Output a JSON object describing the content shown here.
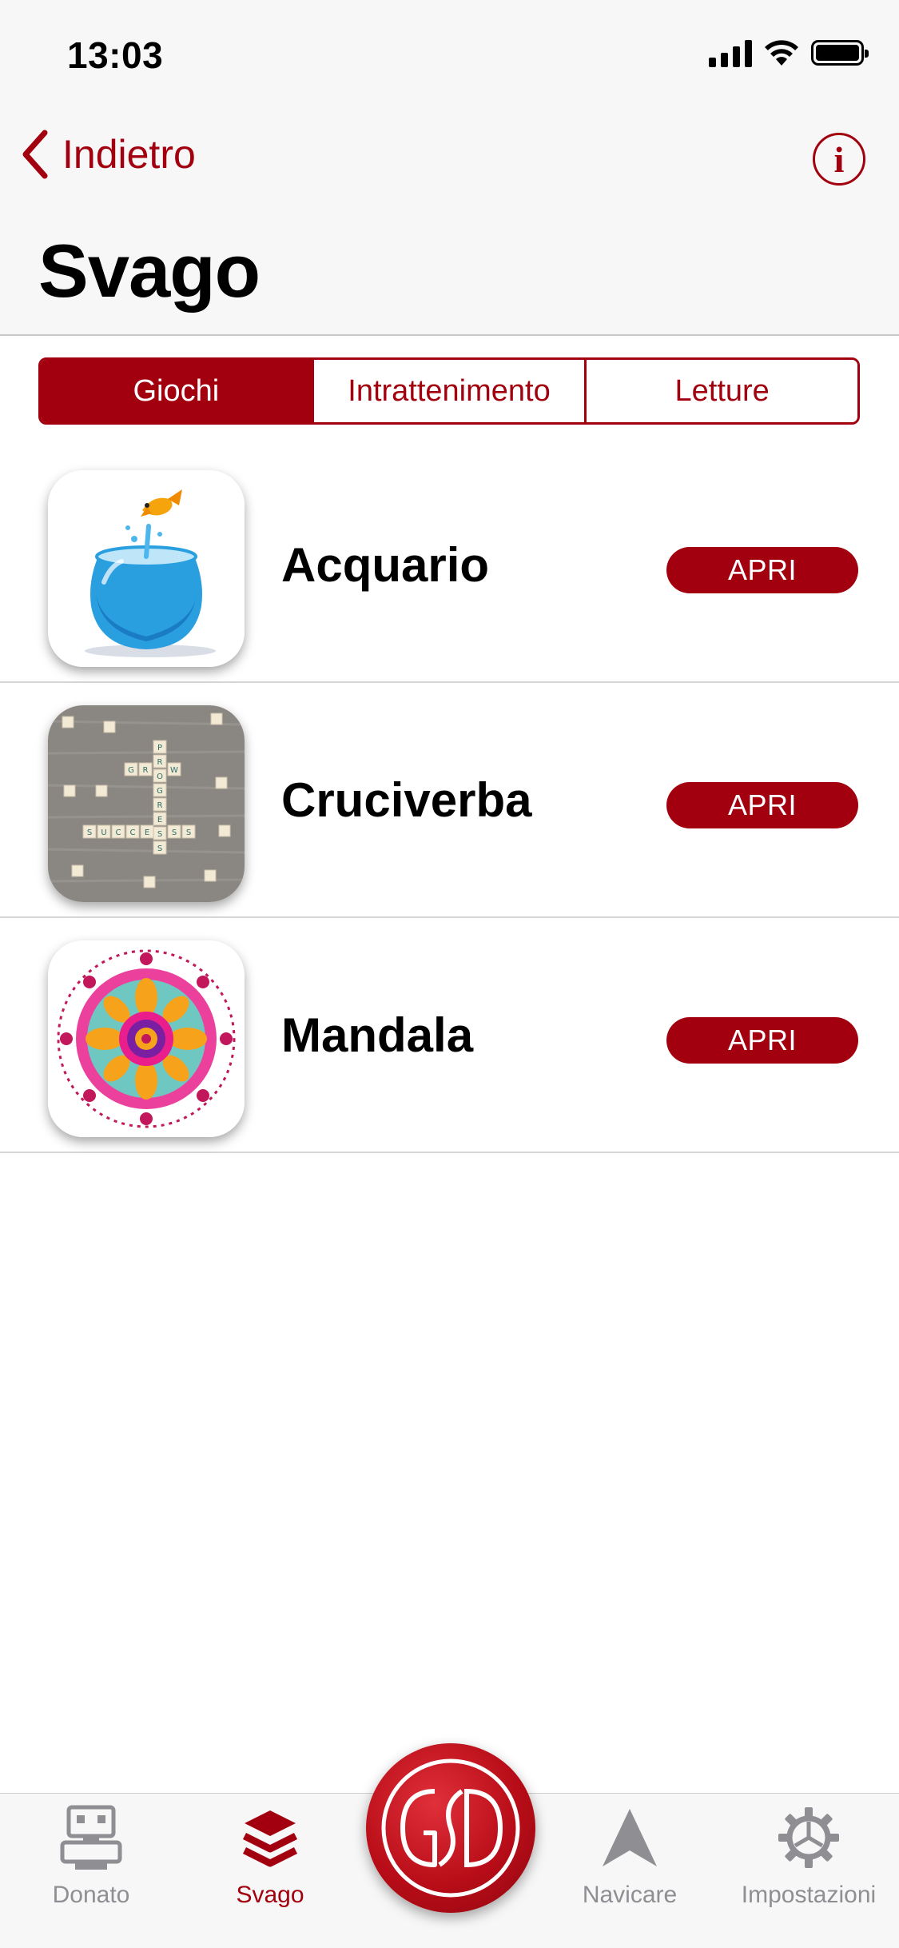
{
  "status_bar": {
    "time": "13:03"
  },
  "nav": {
    "back_label": "Indietro",
    "info_icon": "info-icon",
    "title": "Svago"
  },
  "segments": [
    {
      "label": "Giochi",
      "active": true
    },
    {
      "label": "Intrattenimento",
      "active": false
    },
    {
      "label": "Letture",
      "active": false
    }
  ],
  "items": [
    {
      "title": "Acquario",
      "button": "APRI",
      "thumb": "fishbowl-image"
    },
    {
      "title": "Cruciverba",
      "button": "APRI",
      "thumb": "scrabble-tiles-image"
    },
    {
      "title": "Mandala",
      "button": "APRI",
      "thumb": "mandala-image"
    }
  ],
  "tabbar": {
    "tabs": [
      {
        "label": "Donato",
        "icon": "robot-icon",
        "active": false
      },
      {
        "label": "Svago",
        "icon": "layers-icon",
        "active": true
      },
      {
        "label": "Navicare",
        "icon": "navigate-icon",
        "active": false
      },
      {
        "label": "Impostazioni",
        "icon": "gear-icon",
        "active": false
      }
    ],
    "center_logo": "GSD"
  },
  "colors": {
    "accent": "#a3000f",
    "inactive": "#8e8e93",
    "header_bg": "#f7f7f7"
  }
}
